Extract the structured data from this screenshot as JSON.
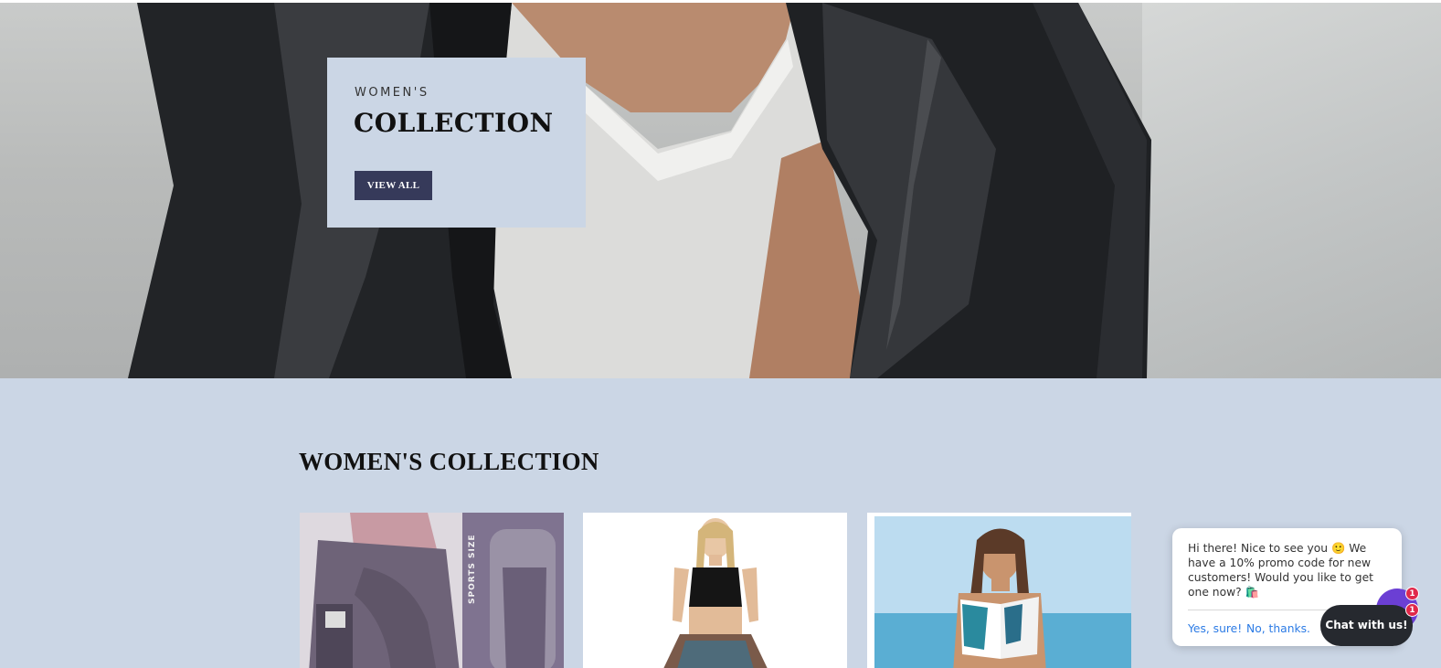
{
  "hero": {
    "eyebrow": "WOMEN'S",
    "title": "COLLECTION",
    "button_label": "VIEW ALL"
  },
  "collection": {
    "heading": "WOMEN'S COLLECTION",
    "products": [
      {
        "image": "purple-leggings-photo",
        "image_text": "SPORTS SIZE"
      },
      {
        "image": "woman-crop-top-patterned-pants-photo"
      },
      {
        "image": "woman-swim-top-beach-photo"
      }
    ]
  },
  "chat": {
    "message": "Hi there! Nice to see you 🙂 We have a 10% promo code for new customers! Would you like to get one now? 🛍️",
    "yes_label": "Yes, sure!",
    "no_label": "No, thanks.",
    "launcher_label": "Chat with us!",
    "badge_count": "1"
  },
  "colors": {
    "promo_bg": "#cbd6e5",
    "button_bg": "#363a5a",
    "chat_link": "#2c7be5",
    "launcher": "#6b3fd4",
    "badge": "#e0284a"
  }
}
